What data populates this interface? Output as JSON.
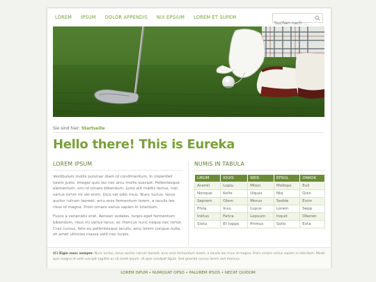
{
  "nav": {
    "items": [
      "LOREM",
      "IPSUM",
      "DOLOR APPENDIS",
      "NIX EPSIUM",
      "LOREM ET SUPEM"
    ]
  },
  "search": {
    "placeholder": "Suchen nach ..."
  },
  "breadcrumb": {
    "prefix": "Sie sind hier:",
    "current": "Startseite"
  },
  "page_title": "Hello there! This is Eureka",
  "left": {
    "heading": "LOREM IPSUM",
    "para1": "Vestibulum mollis pulvinar diam id condimentum. In imperdiet lorem justo. Integer quis leo nec arcu mollis suscipit. Pellentesque elementum, orci id ornare bibendum, justo elit mattis lectus, non varius tortor mi vel enim. Duis vel odio risus. Nunc luctus, lacus auctor rutrum laoreet, arcu eros fermentum lorem, a iaculis leo risus id magna. Proin ornare varius sapien in interdum.",
    "para2": "Fusce a venenatis erat. Aenean sodales, turpis eget fermentum bibendum, risus mi varius lacus, ac rhoncus nunc neque nec tortor. Cras cursus, felis eu pellentesque iaculis, arcu lorem congue nulla, sit amet ultricies massa velit nec turpis."
  },
  "right": {
    "heading": "NUMIS IN TABULA",
    "columns": [
      "LIRUM",
      "IQUIS",
      "NEIS",
      "EPSUL",
      "ONKOK"
    ],
    "rows": [
      [
        "Aramli",
        "Lopiu",
        "Mlooi",
        "Mollopo",
        "Eull"
      ],
      [
        "Nonque",
        "Kolle",
        "Ulquis",
        "Nlq",
        "Quis"
      ],
      [
        "Seprem",
        "Olem",
        "Morus",
        "Sedde",
        "Exim"
      ],
      [
        "Phila",
        "Inxs",
        "Lupus",
        "Lorem",
        "Sepp"
      ],
      [
        "Inktus",
        "Fahra",
        "Lepsum",
        "Inquit",
        "Oberon"
      ],
      [
        "Sixtu",
        "Et loppo",
        "Primus",
        "Solio",
        "Exta"
      ]
    ]
  },
  "footer": {
    "lead": "(C) Elgin nunc semper.",
    "text": "Nunc luctus, lacus auctor rutrum laoreet, arcu eros fermentum lorem, a iaculis leo risus id magna. Proin ornare varius sapien in interdum. Morbi quis magna id velit suscipit sagittis ac sit amet ipsum. Ut quis volutpat ligula. Sed gravida cursus lorem sed rhoncus."
  },
  "bottom_nav": [
    "LOREM ISPUM",
    "NUMQUAT OPSO",
    "PALUREM IPSOS",
    "NECAT QUIDOM"
  ],
  "bottom_nav_separator": "•",
  "colors": {
    "accent": "#7aa03c",
    "table_header": "#6a8c35",
    "page_bg": "#f2f2ef"
  },
  "hero": {
    "alt": "golf-scene"
  }
}
